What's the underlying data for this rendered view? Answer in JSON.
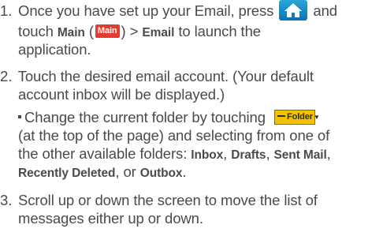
{
  "steps": [
    {
      "number": "1.",
      "line1_before": "Once you have set up your Email, press",
      "line1_after": "and",
      "line2_before": "touch",
      "main_bold": "Main",
      "main_paren_open": " (",
      "main_button_label": "Main",
      "main_paren_close": ")",
      "arrow": ">",
      "email_bold": "Email",
      "line2_after": "to launch the",
      "line3": "application."
    },
    {
      "number": "2.",
      "line1": "Touch the desired email account. (Your default",
      "line2": "account inbox will be displayed.)",
      "bullet": {
        "line1": "Change the current folder by touching",
        "folder_button_label": "Folder",
        "folder_button_caret": "▼",
        "line2": "(at the top of the page) and selecting from one of",
        "line3_before": "the other available folders:",
        "inbox": "Inbox",
        "comma1": ",",
        "drafts": "Drafts",
        "comma2": ",",
        "sent_mail": "Sent Mail",
        "comma3": ",",
        "recently_deleted": "Recently Deleted",
        "or_text": ", or",
        "outbox": "Outbox",
        "period": "."
      }
    },
    {
      "number": "3.",
      "line1": "Scroll up or down the screen to move the list of",
      "line2": "messages either up or down."
    }
  ],
  "colors": {
    "text": "#4a4a4a",
    "home_button": "#1a8cc8",
    "main_button": "#e53a2f",
    "folder_button": "#f2c200"
  },
  "icons": {
    "home": "home-icon",
    "main": "main-button-icon",
    "folder": "folder-dropdown-icon"
  }
}
